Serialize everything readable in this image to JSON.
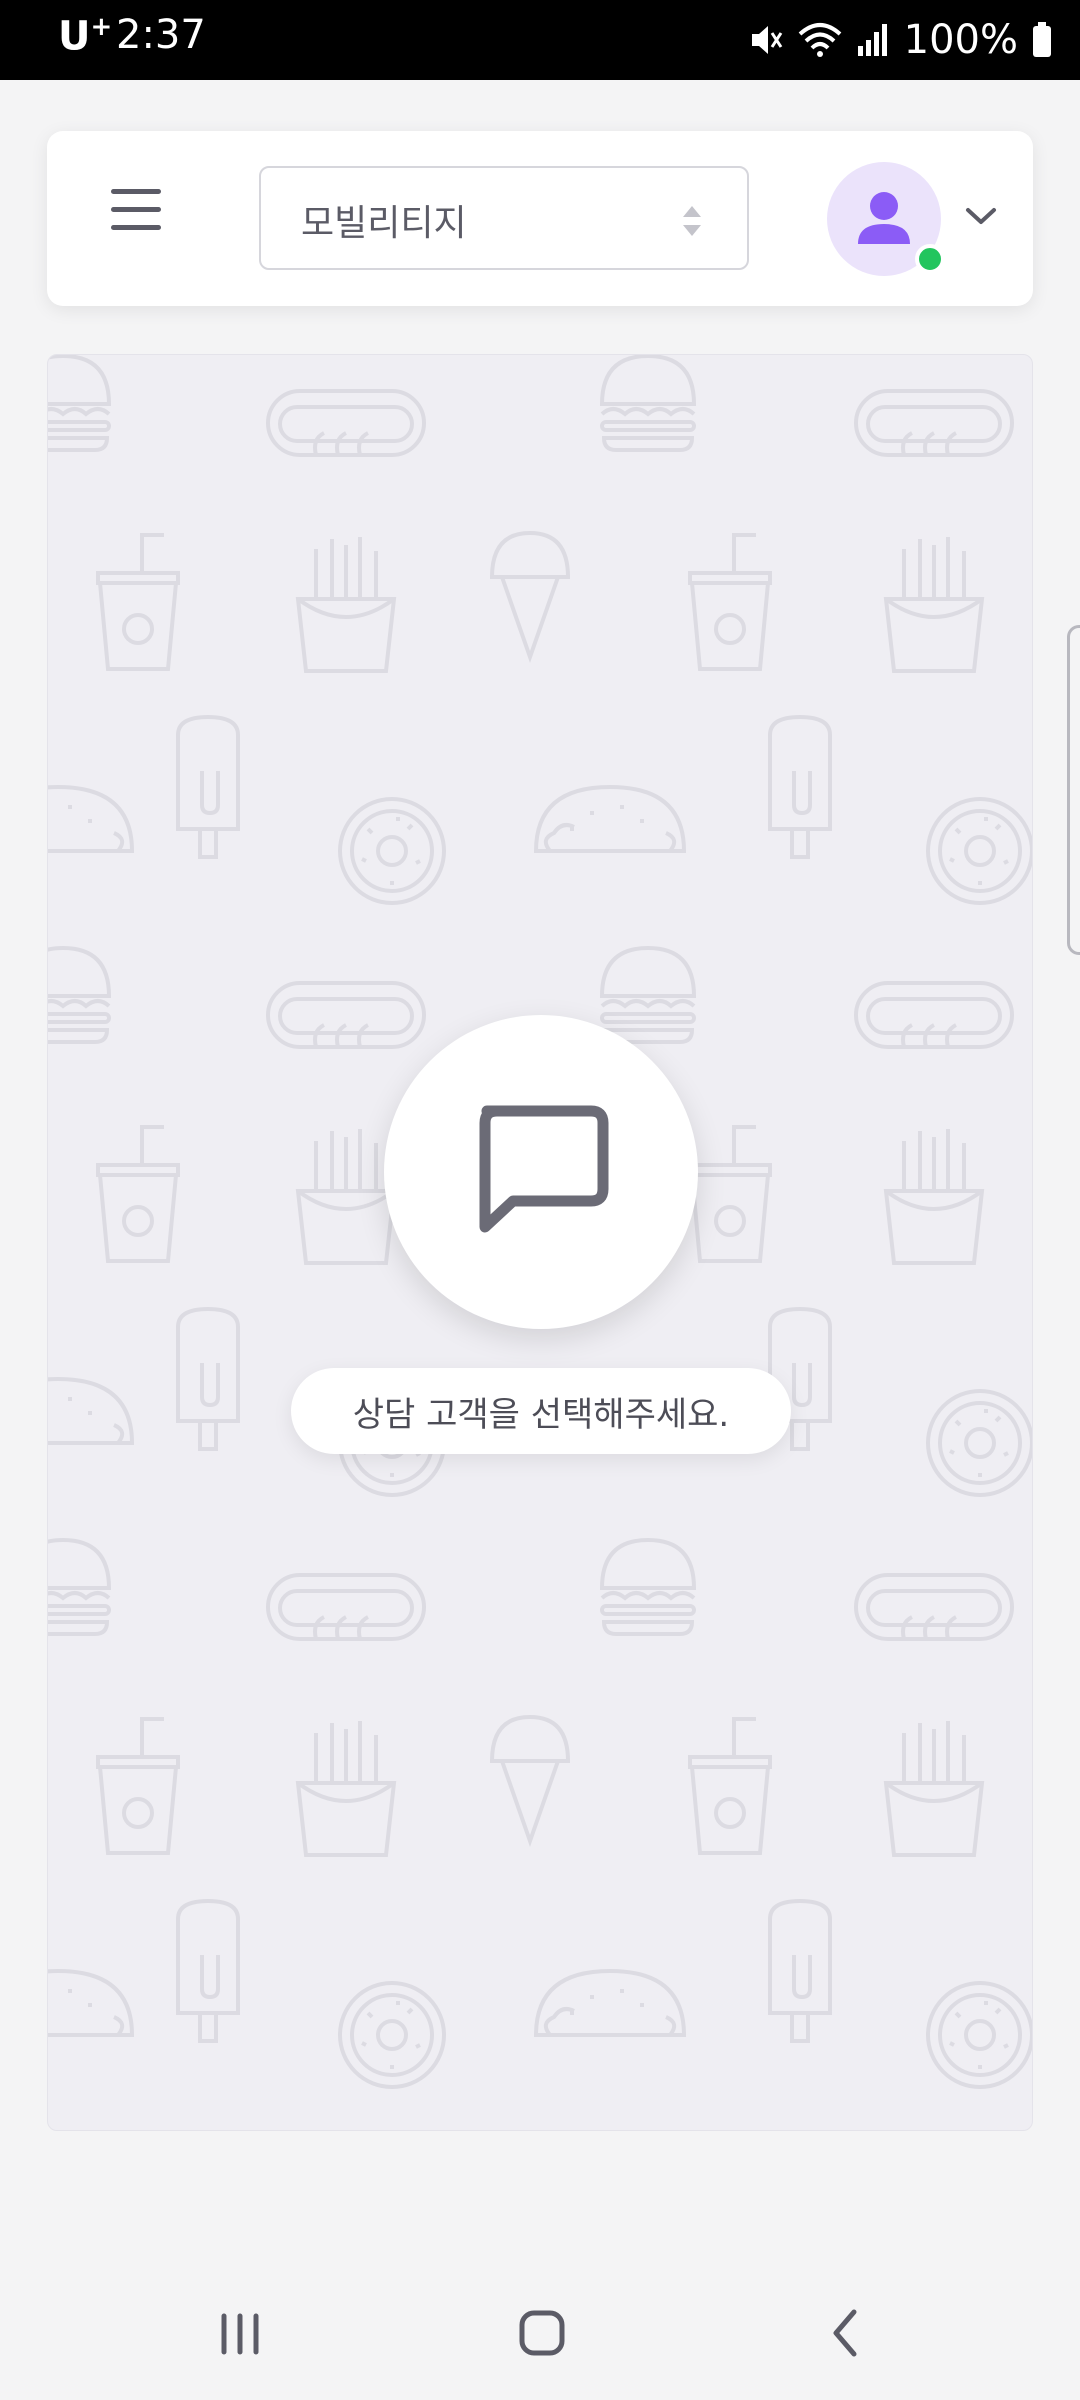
{
  "status_bar": {
    "carrier": "U",
    "carrier_plus": "+",
    "time": "2:37",
    "battery": "100%",
    "icons": [
      "mute-icon",
      "wifi-icon",
      "signal-icon",
      "battery-icon"
    ]
  },
  "header": {
    "menu_icon": "hamburger-menu-icon",
    "select_value": "모빌리티지",
    "avatar_icon": "user-icon",
    "status_color": "#22c55e",
    "dropdown_icon": "chevron-down-icon"
  },
  "chat": {
    "empty_icon": "chat-bubble-icon",
    "empty_message": "상담 고객을 선택해주세요."
  },
  "nav": {
    "recent_icon": "recent-apps-icon",
    "home_icon": "home-icon",
    "back_icon": "back-icon"
  },
  "colors": {
    "accent_purple": "#8b5cf6",
    "avatar_bg": "#ebe3fb",
    "online": "#22c55e"
  }
}
